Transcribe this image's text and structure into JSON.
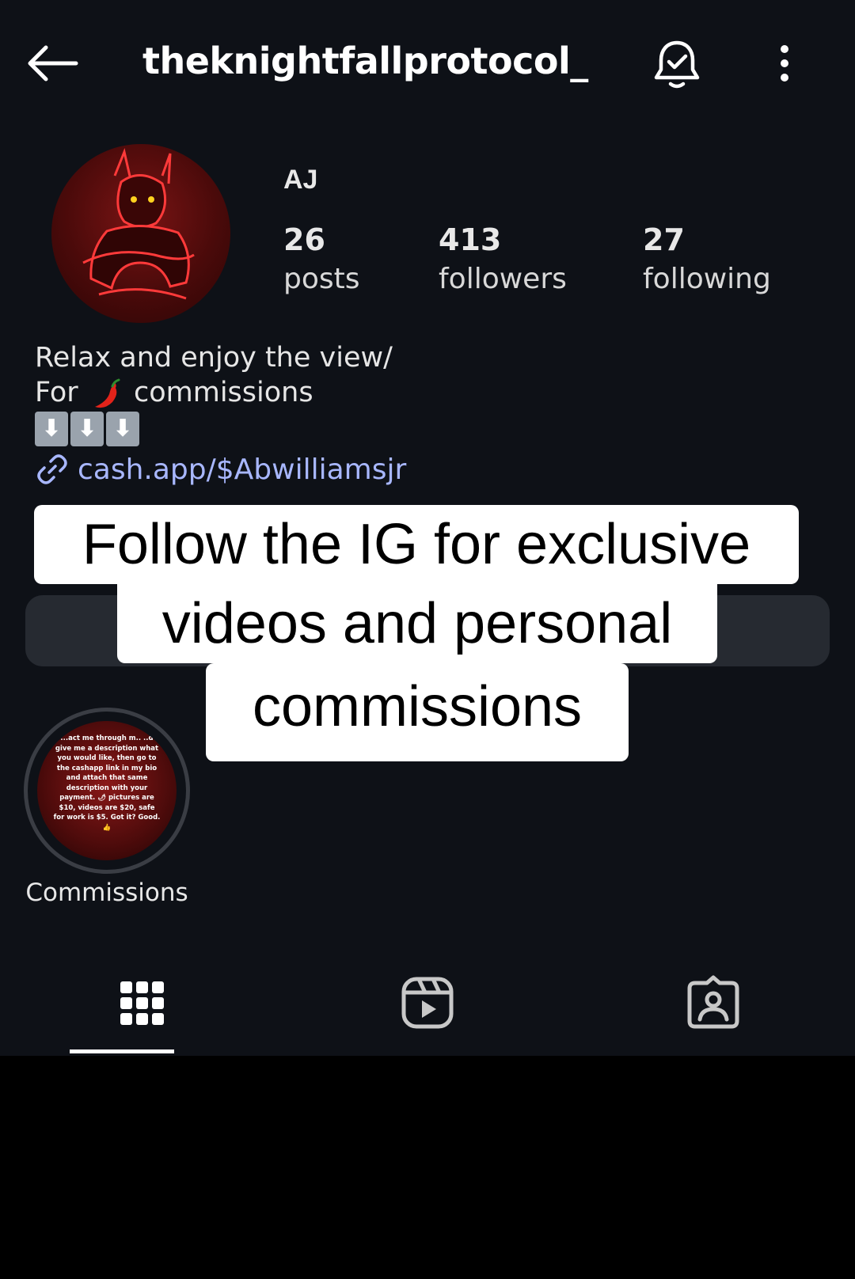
{
  "header": {
    "username": "theknightfallprotocol_"
  },
  "profile": {
    "display_name": "AJ",
    "stats": [
      {
        "number": "26",
        "label": "posts"
      },
      {
        "number": "413",
        "label": "followers"
      },
      {
        "number": "27",
        "label": "following"
      }
    ],
    "bio_line1": "Relax and enjoy the view/",
    "bio_line2_prefix": "For",
    "bio_line2_suffix": "commissions",
    "bio_arrows": [
      "⬇",
      "⬇",
      "⬇"
    ],
    "link": "cash.app/$Abwilliamsjr"
  },
  "overlay": {
    "line1": "Follow the IG for exclusive",
    "line2": "videos and personal",
    "line3": "commissions"
  },
  "highlight": {
    "label": "Commissions",
    "cover_text": "...act me through m.. ..d give me a description what you would like, then go to the cashapp link in my bio and attach that same description with your payment. 🌶 pictures are $10, videos are $20, safe for work is $5. Got it? Good. 👍"
  },
  "tabs": [
    {
      "icon": "grid-icon"
    },
    {
      "icon": "reels-icon"
    },
    {
      "icon": "tagged-icon"
    }
  ],
  "colors": {
    "background": "#0e1117",
    "link": "#a8b7ff",
    "button_bar": "#262a31",
    "overlay_bg": "#ffffff"
  }
}
